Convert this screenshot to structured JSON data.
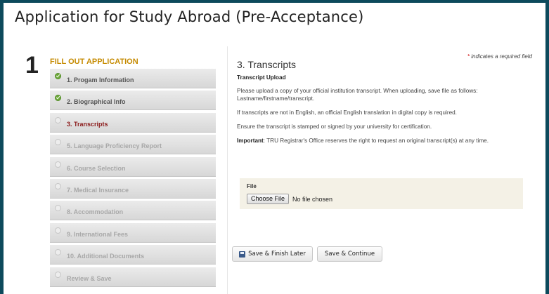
{
  "page": {
    "title": "Application for Study Abroad (Pre-Acceptance)"
  },
  "steps": {
    "number": "1",
    "heading": "FILL OUT APPLICATION",
    "items": [
      {
        "label": "1. Progam Information",
        "state": "done"
      },
      {
        "label": "2. Biographical Info",
        "state": "done"
      },
      {
        "label": "3. Transcripts",
        "state": "active"
      },
      {
        "label": "5. Language Proficiency Report",
        "state": "pending"
      },
      {
        "label": "6. Course Selection",
        "state": "pending"
      },
      {
        "label": "7. Medical Insurance",
        "state": "pending"
      },
      {
        "label": "8. Accommodation",
        "state": "pending"
      },
      {
        "label": "9. International Fees",
        "state": "pending"
      },
      {
        "label": "10. Additional Documents",
        "state": "pending"
      },
      {
        "label": "Review & Save",
        "state": "pending"
      }
    ]
  },
  "form": {
    "required_star": "*",
    "required_note": " indicates a required field",
    "section_title": "3. Transcripts",
    "subheading": "Transcript Upload",
    "paragraph1": "Please upload a copy of your official institution transcript. When uploading, save file as follows: Lastname/firstname/transcript.",
    "paragraph2": "If transcripts are not in English, an official English translation in digital copy is required.",
    "paragraph3": "Ensure the transcript is stamped or signed by your university for certification.",
    "important_label": "Important",
    "important_text": ": TRU Registrar's Office reserves the right to request an original transcript(s) at any time.",
    "file": {
      "label": "File",
      "button_label": "Choose File",
      "status": "No file chosen"
    }
  },
  "actions": {
    "save_later_label": "Save & Finish Later",
    "save_continue_label": "Save & Continue"
  },
  "colors": {
    "background": "#0d4a5c",
    "heading_accent": "#c58a00",
    "active_step": "#8b1a1a",
    "done_check": "#6da838"
  }
}
